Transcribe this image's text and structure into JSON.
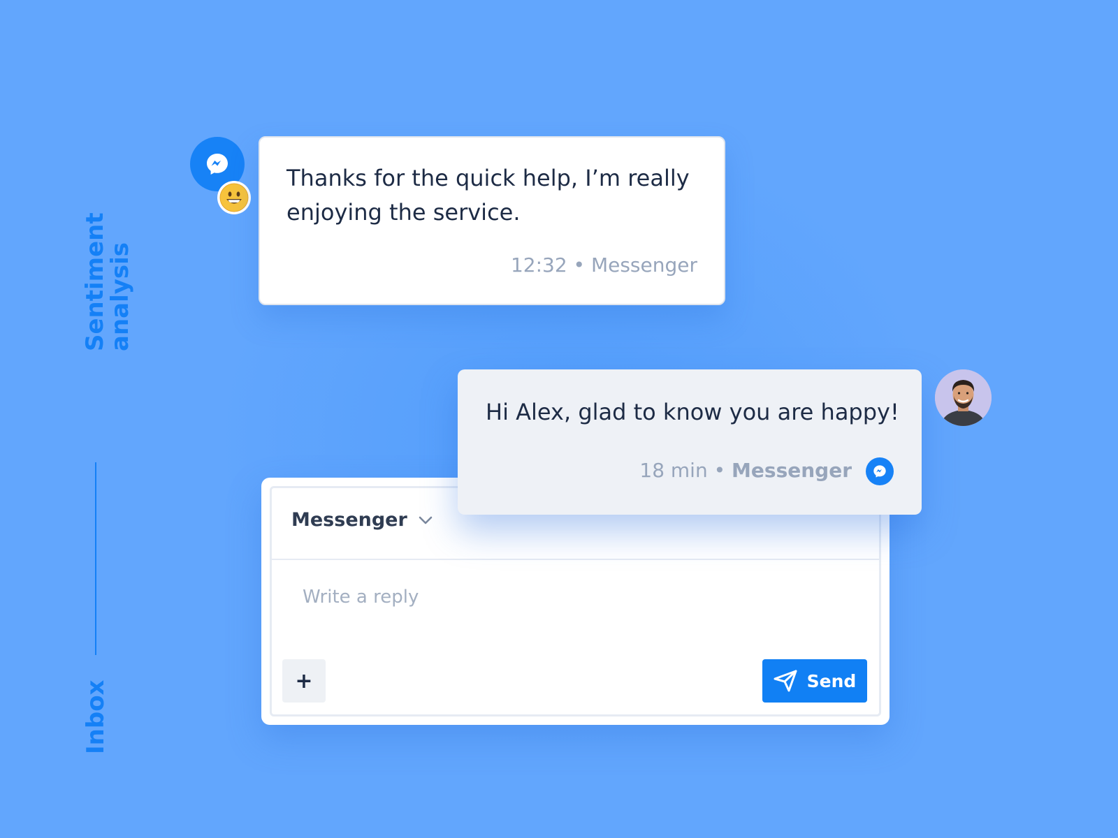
{
  "side": {
    "title_line1": "Sentiment",
    "title_line2": "analysis",
    "section": "Inbox"
  },
  "incoming": {
    "text": "Thanks for the quick help, I’m really enjoying the service.",
    "meta": "12:32 • Messenger",
    "channel_icon": "messenger-icon",
    "sentiment_icon": "smiley-emoji-icon"
  },
  "outgoing": {
    "text": "Hi Alex, glad to know you are happy!",
    "time": "18 min",
    "separator": "•",
    "channel": "Messenger",
    "channel_icon": "messenger-icon"
  },
  "reply": {
    "channel": "Messenger",
    "placeholder": "Write a reply",
    "plus_label": "+",
    "send_label": "Send"
  },
  "colors": {
    "background": "#62a6fd",
    "accent": "#1480f6",
    "messenger": "#1782f6",
    "send_button": "#1180f4",
    "text_dark": "#1d2b45",
    "text_muted": "#97a5bb"
  }
}
